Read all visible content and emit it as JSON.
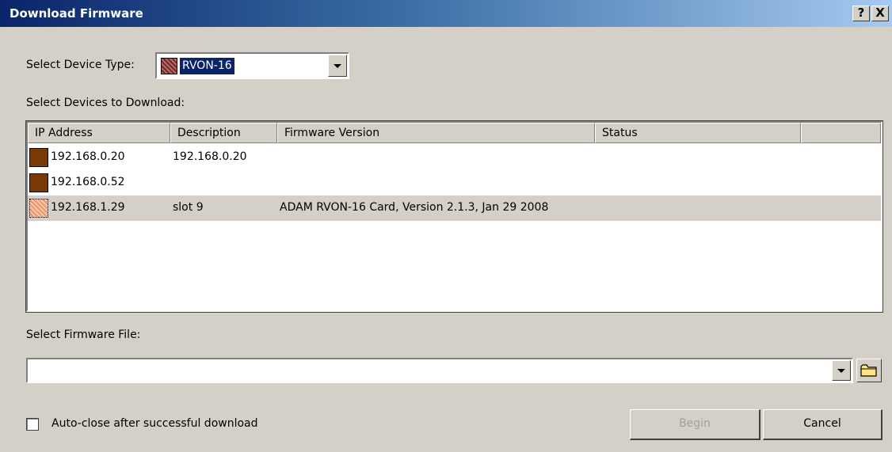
{
  "window": {
    "title": "Download Firmware",
    "help_label": "?",
    "close_label": "X"
  },
  "device_type": {
    "label": "Select Device Type:",
    "value": "RVON-16"
  },
  "devices": {
    "label": "Select Devices to Download:",
    "columns": [
      "IP Address",
      "Description",
      "Firmware Version",
      "Status",
      ""
    ],
    "rows": [
      {
        "ip": "192.168.0.20",
        "description": "192.168.0.20",
        "firmware": "",
        "status": "",
        "icon": "device-dark-icon",
        "selected": false
      },
      {
        "ip": "192.168.0.52",
        "description": "",
        "firmware": "",
        "status": "",
        "icon": "device-dark-icon",
        "selected": false
      },
      {
        "ip": "192.168.1.29",
        "description": "slot 9",
        "firmware": "ADAM RVON-16 Card, Version 2.1.3, Jan 29 2008",
        "status": "",
        "icon": "device-light-icon",
        "selected": true
      }
    ]
  },
  "firmware_file": {
    "label": "Select Firmware File:",
    "value": "",
    "browse_icon": "folder-icon"
  },
  "auto_close": {
    "label": "Auto-close after successful download",
    "checked": false
  },
  "buttons": {
    "begin": "Begin",
    "cancel": "Cancel"
  },
  "colors": {
    "title_gradient_start": "#0a246a",
    "title_gradient_end": "#a6caf0",
    "face": "#d4d0c8",
    "selection": "#0a246a",
    "device_dark": "#7b3a05",
    "device_light": "#f0b088",
    "disabled_text": "#a0a0a0"
  }
}
